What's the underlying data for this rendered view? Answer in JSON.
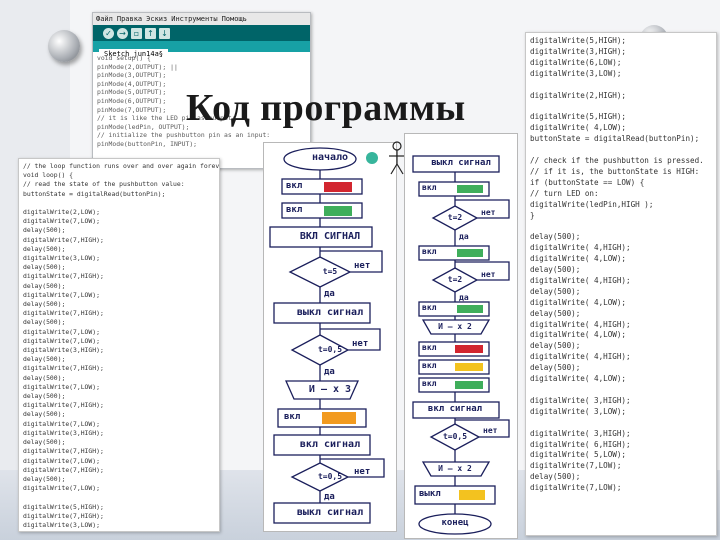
{
  "page": {
    "title": "Код программы"
  },
  "ide": {
    "menu": [
      "Файл",
      "Правка",
      "Эскиз",
      "Инструменты",
      "Помощь"
    ],
    "toolbar_icons": [
      "check-icon",
      "arrow-right-icon",
      "new-file-icon",
      "open-icon",
      "save-icon"
    ],
    "tab": "Sketch_jun14a§",
    "code": [
      "void setup() {",
      "pinMode(2,OUTPUT); ||",
      "pinMode(3,OUTPUT);",
      "pinMode(4,OUTPUT);",
      "pinMode(5,OUTPUT);",
      "pinMode(6,OUTPUT);",
      "pinMode(7,OUTPUT);",
      "// it is like the LED pin as output:",
      "pinMode(ledPin, OUTPUT);",
      "// initialize the pushbutton pin as an input:",
      "pinMode(buttonPin, INPUT);"
    ]
  },
  "left_code": {
    "lines": [
      "// the loop function runs over and over again forever",
      "void loop() {",
      "// read the state of the pushbutton value:",
      "buttonState = digitalRead(buttonPin);",
      "",
      "digitalWrite(2,LOW);",
      "digitalWrite(7,LOW);",
      "delay(500);",
      "digitalWrite(7,HIGH);",
      "delay(500);",
      "digitalWrite(3,LOW);",
      "delay(500);",
      "digitalWrite(7,HIGH);",
      "delay(500);",
      "digitalWrite(7,LOW);",
      "delay(500);",
      "digitalWrite(7,HIGH);",
      "delay(500);",
      "digitalWrite(7,LOW);",
      "digitalWrite(7,LOW);",
      "digitalWrite(3,HIGH);",
      "delay(500);",
      "digitalWrite(7,HIGH);",
      "delay(500);",
      "digitalWrite(7,LOW);",
      "delay(500);",
      "digitalWrite(7,HIGH);",
      "delay(500);",
      "digitalWrite(7,LOW);",
      "digitalWrite(3,HIGH);",
      "delay(500);",
      "digitalWrite(7,HIGH);",
      "digitalWrite(7,LOW);",
      "digitalWrite(7,HIGH);",
      "delay(500);",
      "digitalWrite(7,LOW);",
      "",
      "digitalWrite(5,HIGH);",
      "digitalWrite(7,HIGH);",
      "digitalWrite(3,LOW);",
      "digitalWrite(7,LOW);"
    ]
  },
  "right_code": {
    "lines": [
      "digitalWrite(5,HIGH);",
      "digitalWrite(3,HIGH);",
      "digitalWrite(6,LOW);",
      "digitalWrite(3,LOW);",
      "",
      "digitalWrite(2,HIGH);",
      "",
      "digitalWrite(5,HIGH);",
      "digitalWrite( 4,LOW);",
      "buttonState = digitalRead(buttonPin);",
      "",
      "// check if the pushbutton is pressed.",
      "// if it is, the buttonState is HIGH:",
      "if (buttonState == LOW) {",
      "// turn LED on:",
      "digitalWrite(ledPin,HIGH );",
      "}",
      "",
      "delay(500);",
      "digitalWrite( 4,HIGH);",
      "digitalWrite( 4,LOW);",
      "delay(500);",
      "digitalWrite( 4,HIGH);",
      "delay(500);",
      "digitalWrite( 4,LOW);",
      "delay(500);",
      "digitalWrite( 4,HIGH);",
      "digitalWrite( 4,LOW);",
      "delay(500);",
      "digitalWrite( 4,HIGH);",
      "delay(500);",
      "digitalWrite( 4,LOW);",
      "",
      "digitalWrite( 3,HIGH);",
      "digitalWrite( 3,LOW);",
      "",
      "digitalWrite( 3,HIGH);",
      "digitalWrite( 6,HIGH);",
      "digitalWrite( 5,LOW);",
      "digitalWrite(7,LOW);",
      "delay(500);",
      "digitalWrite(7,LOW);"
    ]
  },
  "flow_a": {
    "start": "начало",
    "on1": "вкл",
    "on2": "вкл",
    "signal_on_1": "ВКЛ СИГНАЛ",
    "cond_1": "t=5",
    "no_1": "нет",
    "yes_1": "да",
    "signal_off_1": "выкл сигнал",
    "cond_2": "t=0,5",
    "no_2": "нет",
    "yes_2": "да",
    "loop_1": "И – х 3",
    "on3": "вкл",
    "signal_on_2": "вкл сигнал",
    "cond_3": "t=0,5",
    "no_3": "нет",
    "yes_3": "да",
    "signal_off_2": "выкл сигнал"
  },
  "flow_b": {
    "signal_off_1": "выкл сигнал",
    "on_1": "вкл",
    "no_1": "нет",
    "cond_1": "t=2",
    "yes_1": "да",
    "on_2": "вкл",
    "no_2": "нет",
    "cond_2": "t=2",
    "yes_2": "да",
    "off_1": "вкл",
    "loop_1": "И – х 2",
    "on_3": "вкл",
    "on_4": "вкл",
    "on_5": "вкл",
    "signal_on": "вкл сигнал",
    "cond_3": "t=0,5",
    "no_3": "нет",
    "loop_2": "И – х 2",
    "off_2": "выкл",
    "end": "конец"
  },
  "colors": {
    "toolbar": "#006468",
    "tabs": "#17a1a5",
    "red": "#d2262f",
    "green": "#3fae5b",
    "yellow": "#f3c21f",
    "orange": "#f29a1f",
    "ink": "#1b1f5c"
  }
}
